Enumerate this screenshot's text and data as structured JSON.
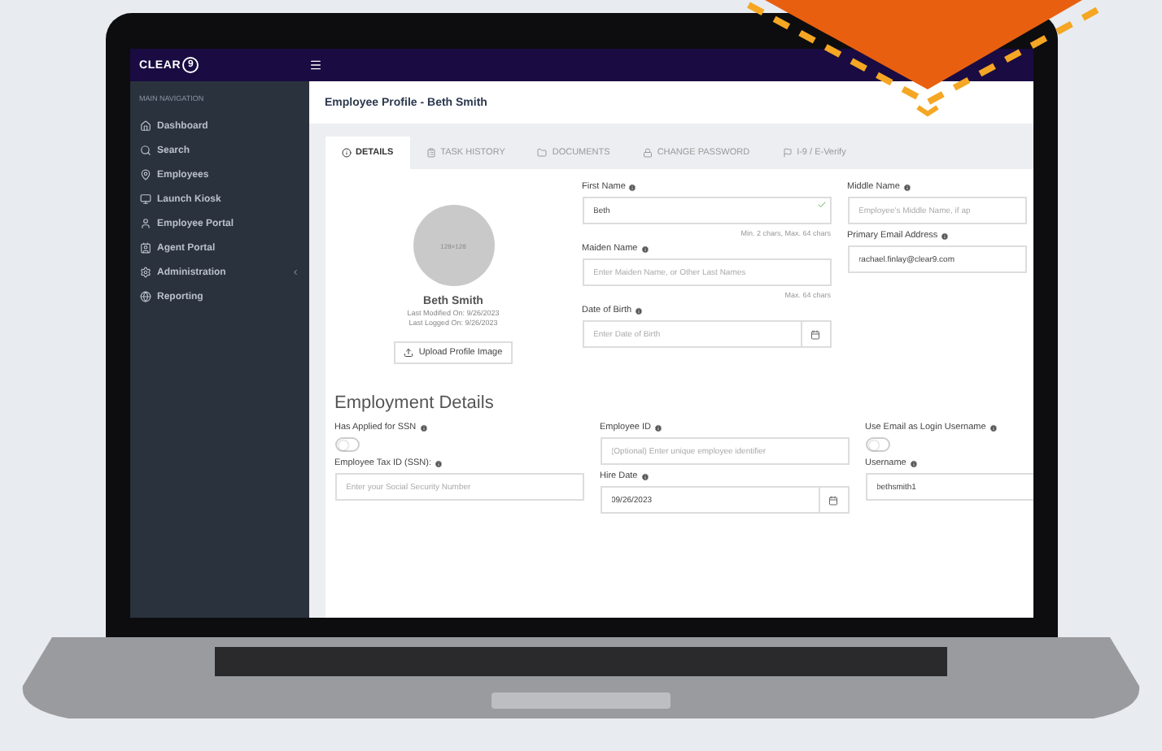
{
  "logo": {
    "word": "CLEAR",
    "mark": "9"
  },
  "sidebar": {
    "heading": "MAIN NAVIGATION",
    "items": [
      {
        "label": "Dashboard",
        "selected": false,
        "has_submenu": false
      },
      {
        "label": "Search",
        "selected": false,
        "has_submenu": false
      },
      {
        "label": "Employees",
        "selected": false,
        "has_submenu": false
      },
      {
        "label": "Launch Kiosk",
        "selected": false,
        "has_submenu": false
      },
      {
        "label": "Employee Portal",
        "selected": false,
        "has_submenu": false
      },
      {
        "label": "Agent Portal",
        "selected": false,
        "has_submenu": false
      },
      {
        "label": "Administration",
        "selected": false,
        "has_submenu": true
      },
      {
        "label": "Reporting",
        "selected": false,
        "has_submenu": false
      }
    ]
  },
  "page_title": "Employee Profile - Beth Smith",
  "tabs": [
    {
      "label": "DETAILS",
      "selected": true
    },
    {
      "label": "TASK HISTORY",
      "selected": false
    },
    {
      "label": "DOCUMENTS",
      "selected": false
    },
    {
      "label": "CHANGE PASSWORD",
      "selected": false
    },
    {
      "label": "I-9 / E-Verify",
      "selected": false
    }
  ],
  "profile": {
    "avatar_text": "128×128",
    "name": "Beth Smith",
    "modified": "Last Modified On: 9/26/2023",
    "logged": "Last Logged On: 9/26/2023",
    "upload_button": "Upload Profile Image"
  },
  "profile_columns": [
    [
      {
        "kind": "text",
        "label": "First Name",
        "value": "Beth",
        "valid": true,
        "hint": "Min. 2 chars, Max. 64 chars"
      },
      {
        "kind": "text",
        "label": "Maiden Name",
        "placeholder": "Enter Maiden Name, or Other Last Names",
        "valid": false,
        "hint": "Max. 64 chars"
      },
      {
        "kind": "date",
        "label": "Date of Birth",
        "placeholder": "Enter Date of Birth",
        "valid": false
      }
    ],
    [
      {
        "kind": "text",
        "label": "Middle Name",
        "placeholder": "Employee's Middle Name, if ap",
        "valid": false
      },
      {
        "kind": "text",
        "label": "Primary Email Address",
        "value": "rachael.finlay@clear9.com",
        "valid": false
      }
    ]
  ],
  "employment": {
    "heading": "Employment Details",
    "columns": [
      [
        {
          "kind": "toggle",
          "label": "Has Applied for SSN",
          "on": false
        },
        {
          "kind": "text",
          "label": "Employee Tax ID (SSN):",
          "placeholder": "Enter your Social Security Number",
          "valid": false
        }
      ],
      [
        {
          "kind": "text",
          "label": "Employee ID",
          "placeholder": "(Optional) Enter unique employee identifier",
          "valid": false
        },
        {
          "kind": "date",
          "label": "Hire Date",
          "value": "09/26/2023",
          "valid": false
        }
      ],
      [
        {
          "kind": "toggle",
          "label": "Use Email as Login Username",
          "on": false
        },
        {
          "kind": "text",
          "label": "Username",
          "value": "bethsmith1",
          "valid": false
        }
      ]
    ]
  }
}
